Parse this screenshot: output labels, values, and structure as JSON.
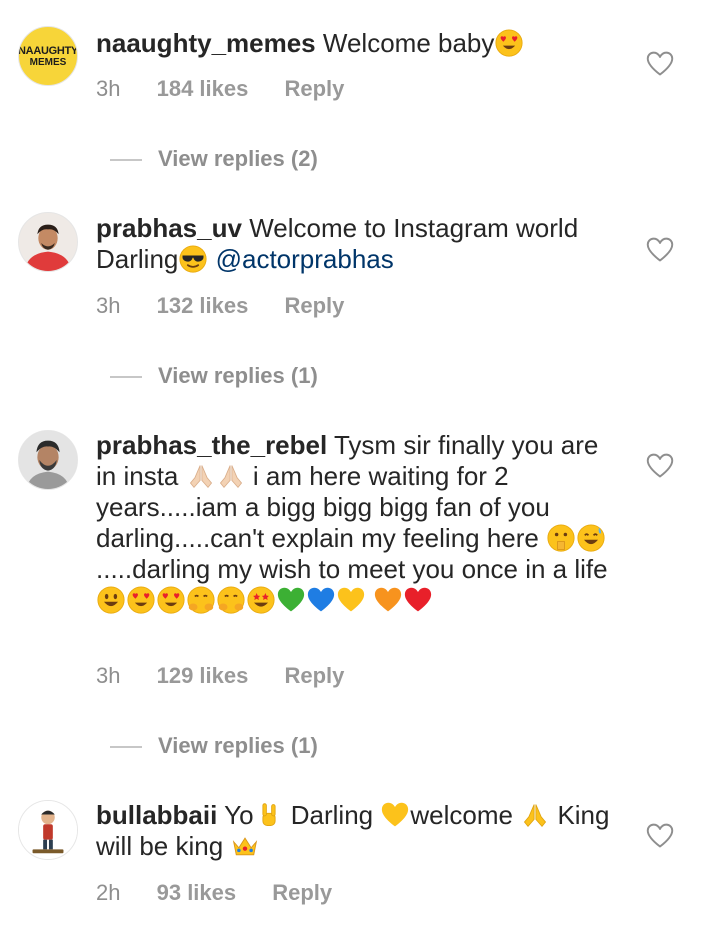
{
  "comments": [
    {
      "username": "naaughty_memes",
      "avatar_text": [
        "NAAUGHTY",
        "MEMES"
      ],
      "text": "Welcome baby",
      "emojis_end": [
        "heart-eyes"
      ],
      "time": "3h",
      "likes": "184 likes",
      "reply": "Reply",
      "view_replies": "View replies (2)"
    },
    {
      "username": "prabhas_uv",
      "text": "Welcome to Instagram world Darling",
      "emojis_end": [
        "sunglasses"
      ],
      "mention": "@actorprabhas",
      "time": "3h",
      "likes": "132 likes",
      "reply": "Reply",
      "view_replies": "View replies (1)"
    },
    {
      "username": "prabhas_the_rebel",
      "text_1": "Tysm sir finally you are in insta",
      "text_2": "i am here waiting for 2 years.....iam a bigg bigg bigg fan of you darling.....can't explain my feeling here",
      "text_3": ".....darling my wish to meet you once in a life",
      "time": "3h",
      "likes": "129 likes",
      "reply": "Reply",
      "view_replies": "View replies (1)"
    },
    {
      "username": "bullabbaii",
      "text_1": "Yo",
      "text_2": "Darling",
      "text_3": "welcome",
      "text_4": "King will be king",
      "time": "2h",
      "likes": "93 likes",
      "reply": "Reply"
    }
  ],
  "colors": {
    "username": "#262626",
    "text": "#262626",
    "mention": "#003569",
    "meta": "#8e8e8e",
    "divider": "#c7c7c7"
  },
  "icons": {
    "like": "heart-outline-icon"
  }
}
